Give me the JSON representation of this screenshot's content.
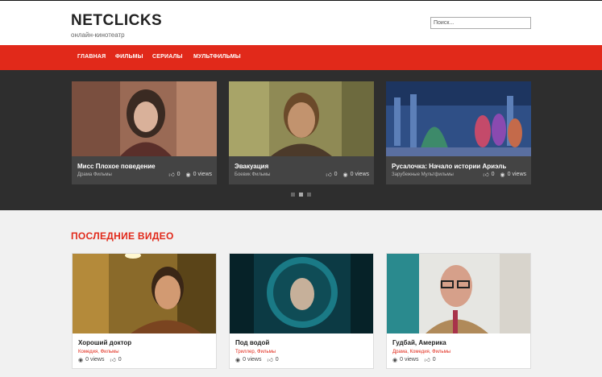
{
  "site": {
    "logo": "NETCLICKS",
    "tagline": "онлайн-кинотеатр",
    "search_placeholder": "Поиск..."
  },
  "nav": {
    "items": [
      "ГЛАВНАЯ",
      "ФИЛЬМЫ",
      "СЕРИАЛЫ",
      "МУЛЬТФИЛЬМЫ"
    ]
  },
  "slider": {
    "slides": [
      {
        "title": "Мисс Плохое поведение",
        "cats": "Драма Фильмы",
        "likes": "0",
        "views": "0 views"
      },
      {
        "title": "Эвакуация",
        "cats": "Боевик Фильмы",
        "likes": "0",
        "views": "0 views"
      },
      {
        "title": "Русалочка: Начало истории Ариэль",
        "cats": "Зарубежные Мультфильмы",
        "likes": "0",
        "views": "0 views"
      }
    ],
    "active_dot": 1
  },
  "latest": {
    "heading": "ПОСЛЕДНИЕ ВИДЕО",
    "cards": [
      {
        "title": "Хороший доктор",
        "cats": "Комедия, Фильмы",
        "views": "0 views",
        "likes": "0"
      },
      {
        "title": "Под водой",
        "cats": "Триллер, Фильмы",
        "views": "0 views",
        "likes": "0"
      },
      {
        "title": "Гудбай, Америка",
        "cats": "Драма, Комедия, Фильмы",
        "views": "0 views",
        "likes": "0"
      }
    ]
  },
  "icons": {
    "like": "thumbs-up-icon",
    "view": "eye-icon"
  },
  "colors": {
    "accent": "#e1291a",
    "slider_bg": "#2e2e2e"
  }
}
